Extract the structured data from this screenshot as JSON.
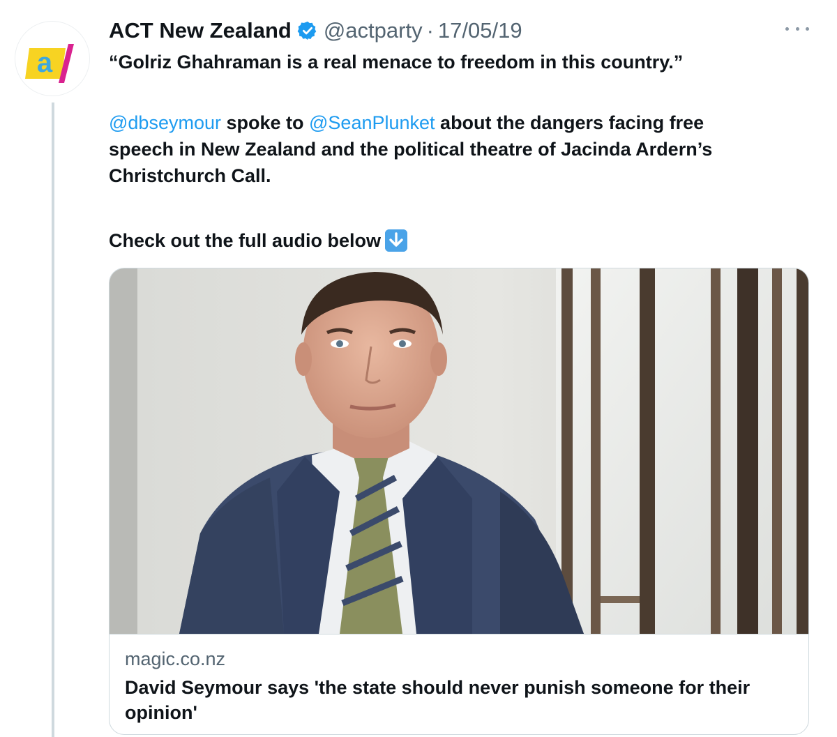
{
  "tweet": {
    "avatar_icon": "act-party-logo",
    "author_name": "ACT New Zealand",
    "verified_icon": "verified-badge-icon",
    "handle": "@actparty",
    "separator": "·",
    "date": "17/05/19",
    "more_icon": "more-options-icon",
    "quote_line": "“Golriz Ghahraman is a real menace to freedom in this country.”",
    "mention1": "@dbseymour",
    "text_mid1": " spoke to ",
    "mention2": "@SeanPlunket",
    "text_rest_line1": " about the dangers facing free",
    "text_line2": "speech in New Zealand and the political theatre of Jacinda Ardern’s",
    "text_line3": "Christchurch Call.",
    "cta": "Check out the full audio below",
    "cta_emoji": "down-arrow-emoji-icon"
  },
  "card": {
    "image_icon": "portrait-photo",
    "domain": "magic.co.nz",
    "title": "David Seymour says 'the state should never punish someone for their opinion'"
  },
  "colors": {
    "link_blue": "#1d9bf0",
    "secondary_text": "#536471",
    "logo_yellow": "#f7d322",
    "logo_blue": "#3ea7dd",
    "logo_magenta": "#d9228f"
  }
}
